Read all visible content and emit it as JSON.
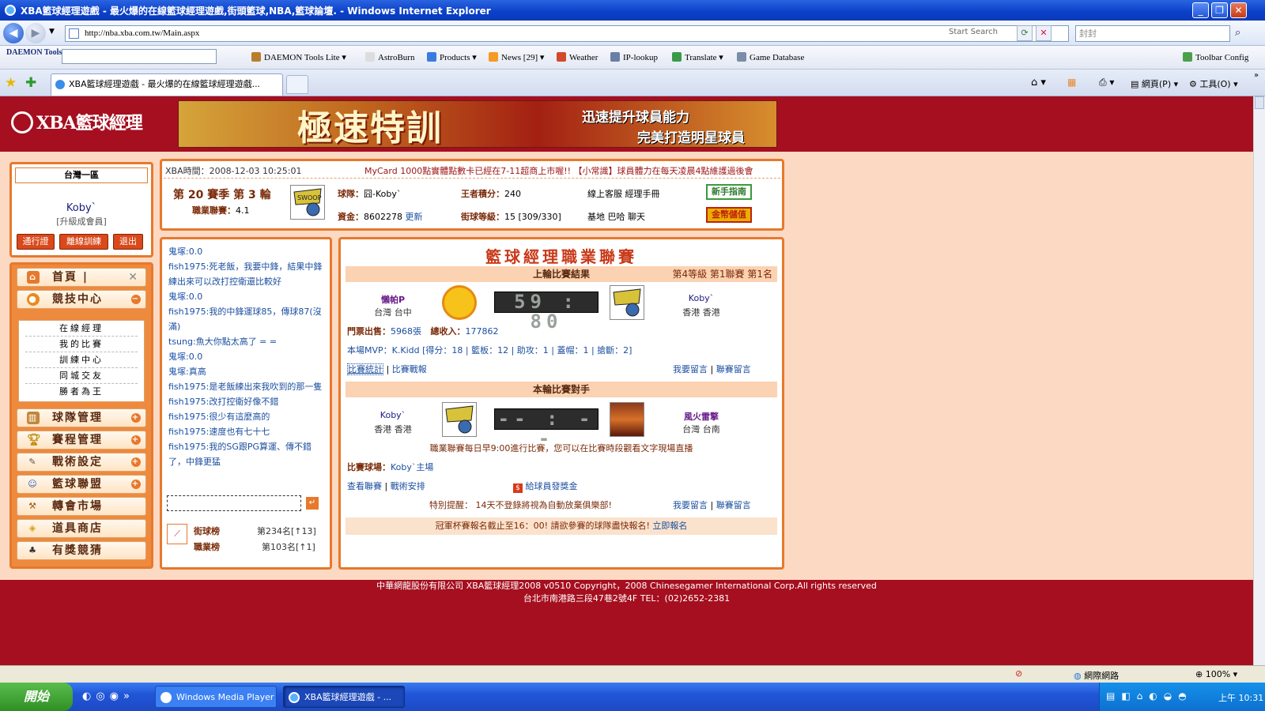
{
  "window": {
    "title": "XBA籃球經理遊戲 - 最火爆的在線籃球經理遊戲,街頭籃球,NBA,籃球論壇. - Windows Internet Explorer"
  },
  "address": {
    "url": "http://nba.xba.com.tw/Main.aspx",
    "start_search": "Start Search",
    "search_value": "封封"
  },
  "toolbar": {
    "brand": "DAEMON Tools",
    "items": [
      "DAEMON Tools Lite",
      "AstroBurn",
      "Products",
      "News [29]",
      "Weather",
      "IP-lookup",
      "Translate",
      "Game Database"
    ],
    "toolbar_config": "Toolbar Config"
  },
  "tabs": {
    "active": "XBA籃球經理遊戲 - 最火爆的在線籃球經理遊戲...",
    "home": "網頁(P)",
    "tools": "工具(O)"
  },
  "site": {
    "logo": "XBA籃球經理",
    "banner_main": "極速特訓",
    "banner_sub1": "迅速提升球員能力",
    "banner_sub2": "完美打造明星球員"
  },
  "user": {
    "server": "台灣一區",
    "name": "Koby`",
    "rank": "[升級成會員]",
    "btn_pass": "通行證",
    "btn_train": "離線訓練",
    "btn_exit": "退出"
  },
  "menu": {
    "home": "首頁",
    "arena": "競技中心",
    "sub": [
      "在線經理",
      "我的比賽",
      "訓練中心",
      "同城交友",
      "勝者為王"
    ],
    "team": "球隊管理",
    "schedule": "賽程管理",
    "tactics": "戰術設定",
    "league": "籃球聯盟",
    "transfer": "轉會市場",
    "shop": "道具商店",
    "prize": "有獎競猜"
  },
  "info": {
    "time_label": "XBA時間：",
    "time": "2008-12-03 10:25:01",
    "marquee": "MyCard 1000點實體點數卡已經在7-11超商上市喔!! 【小常識】球員體力在每天凌晨4點維護過後會",
    "season": "第 20 賽季 第 3 輪",
    "pro_label": "職業聯賽：",
    "pro_val": "4.1",
    "team_label": "球隊：",
    "team_val": "囧-Koby`",
    "king_label": "王者積分：",
    "king_val": "240",
    "cs": "線上客服",
    "manual": "經理手冊",
    "guide": "新手指南",
    "fund_label": "資金：",
    "fund_val": "8602278",
    "refresh": "更新",
    "street_label": "街球等級：",
    "street_val": "15 [309/330]",
    "links": "基地 巴哈 聊天",
    "deposit": "金幣儲值"
  },
  "chat": [
    {
      "n": "鬼塚",
      "t": ":0.0"
    },
    {
      "n": "fish1975",
      "t": ":死老飯，我要中鋒，結果中鋒練出來可以改打控衛還比較好"
    },
    {
      "n": "鬼塚",
      "t": ":0.0"
    },
    {
      "n": "fish1975",
      "t": ":我的中鋒運球85，傳球87(沒滿)"
    },
    {
      "n": "tsung",
      "t": ":魚大你點太高了 = ="
    },
    {
      "n": "鬼塚",
      "t": ":0.0"
    },
    {
      "n": "鬼塚",
      "t": ":真高"
    },
    {
      "n": "fish1975",
      "t": ":是老飯練出來我吹到的那一隻"
    },
    {
      "n": "fish1975",
      "t": ":改打控衛好像不錯"
    },
    {
      "n": "fish1975",
      "t": ":很少有這麼高的"
    },
    {
      "n": "fish1975",
      "t": ":速度也有七十七"
    },
    {
      "n": "fish1975",
      "t": ":我的SG跟PG算運、傳不錯了，中鋒更猛"
    }
  ],
  "ranks": {
    "street": "街球榜",
    "street_val": "第234名[↑13]",
    "pro": "職業榜",
    "pro_val": "第103名[↑1]"
  },
  "league": {
    "title": "籃球經理職業聯賽",
    "last_title": "上輪比賽結果",
    "level": "第4等級 第1聯賽 第1名",
    "home_team": "懶帕P",
    "home_loc": "台灣 台中",
    "score": "59 : 80",
    "away_team": "Koby`",
    "away_loc": "香港 香港",
    "tickets_label": "門票出售：",
    "tickets": "5968張",
    "income_label": "總收入：",
    "income": "177862",
    "mvp": "本場MVP：K.Kidd [得分：18 | 籃板：12 | 助攻：1 | 蓋帽：1 | 搶斷：2]",
    "stats": "比賽統計",
    "report": "比賽戰報",
    "msg": "我要留言",
    "league_msg": "聯賽留言",
    "next_title": "本輪比賽對手",
    "next_home": "Koby`",
    "next_home_loc": "香港 香港",
    "next_score": "-- : --",
    "next_away": "風火雷擎",
    "next_away_loc": "台灣 台南",
    "note": "職業聯賽每日早9:00進行比賽，您可以在比賽時段觀看文字現場直播",
    "venue_label": "比賽球場：",
    "venue": "Koby`主場",
    "view": "查看聯賽",
    "tactic": "戰術安排",
    "bonus": "給球員發獎金",
    "warn": "特別提醒： 14天不登錄將視為自動放棄俱樂部!",
    "cup": "冠軍杯賽報名截止至16：00! 請欲參賽的球隊盡快報名!",
    "signup": "立即報名"
  },
  "footer": {
    "line1": "中華網龍股份有限公司 XBA籃球經理2008 v0510 Copyright，2008 Chinesegamer International Corp.All rights reserved",
    "line2": "台北市南港路三段47巷2號4F TEL：(02)2652-2381"
  },
  "status": {
    "zone": "網際網路",
    "zoom": "100%"
  },
  "taskbar": {
    "start": "開始",
    "t1": "Windows Media Player",
    "t2": "XBA籃球經理遊戲 - ...",
    "time": "上午 10:31"
  }
}
